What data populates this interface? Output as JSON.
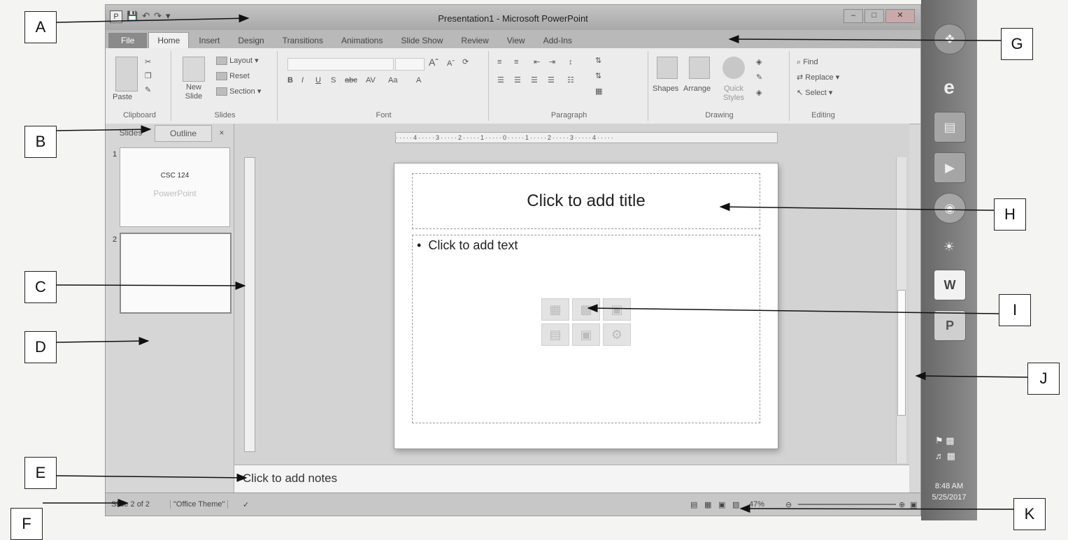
{
  "window": {
    "title": "Presentation1 - Microsoft PowerPoint",
    "app_icon": "P",
    "quick_access": [
      "save-icon",
      "undo-icon",
      "redo-icon",
      "customize-icon"
    ]
  },
  "ribbon": {
    "tabs": [
      {
        "label": "File"
      },
      {
        "label": "Home"
      },
      {
        "label": "Insert"
      },
      {
        "label": "Design"
      },
      {
        "label": "Transitions"
      },
      {
        "label": "Animations"
      },
      {
        "label": "Slide Show"
      },
      {
        "label": "Review"
      },
      {
        "label": "View"
      },
      {
        "label": "Add-Ins"
      }
    ],
    "active_tab": "Home",
    "clipboard": {
      "paste": "Paste",
      "group": "Clipboard"
    },
    "slides": {
      "new_slide": "New Slide",
      "layout": "Layout",
      "reset": "Reset",
      "section": "Section",
      "group": "Slides"
    },
    "font": {
      "group": "Font",
      "buttons": [
        "B",
        "I",
        "U",
        "S",
        "abc",
        "AV",
        "Aa",
        "A"
      ]
    },
    "paragraph": {
      "group": "Paragraph"
    },
    "drawing": {
      "shapes": "Shapes",
      "arrange": "Arrange",
      "quick_styles": "Quick Styles",
      "group": "Drawing"
    },
    "editing": {
      "find": "Find",
      "replace": "Replace",
      "select": "Select",
      "group": "Editing"
    }
  },
  "left_panel": {
    "tabs": [
      "Slides",
      "Outline"
    ],
    "close": "×",
    "thumbnails": [
      {
        "number": "1",
        "title": "CSC 124",
        "subtitle": "PowerPoint"
      },
      {
        "number": "2",
        "title": "",
        "subtitle": ""
      }
    ]
  },
  "editor": {
    "ruler_text": "·····4·····3·····2·····1·····0·····1·····2·····3·····4·····",
    "title_placeholder": "Click to add title",
    "content_placeholder": "Click to add text",
    "bullet": "•",
    "notes_placeholder": "Click to add notes"
  },
  "status_bar": {
    "slide_info": "Slide 2 of 2",
    "theme": "\"Office Theme\"",
    "zoom": "47%"
  },
  "taskbar": {
    "time": "8:48 AM",
    "date": "5/25/2017",
    "icons": [
      "start-orb",
      "ie-icon",
      "explorer-icon",
      "media-player-icon",
      "chrome-icon",
      "app-icon",
      "word-icon",
      "powerpoint-icon"
    ]
  },
  "callouts": [
    "A",
    "B",
    "C",
    "D",
    "E",
    "F",
    "G",
    "H",
    "I",
    "J",
    "K"
  ]
}
